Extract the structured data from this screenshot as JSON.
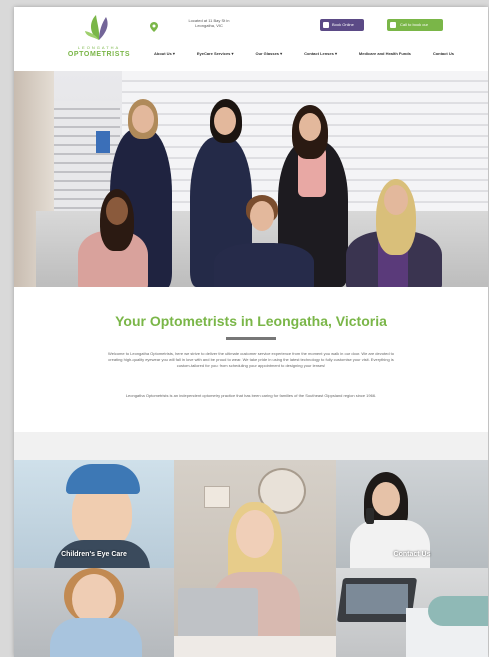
{
  "header": {
    "logo_top": "LEONGATHA",
    "logo_name": "OPTOMETRISTS",
    "location_line1": "Located at 11 Bay St in",
    "location_line2": "Leongatha, VIC",
    "book_label": "Book Online",
    "call_label": "Call to book our"
  },
  "nav": [
    {
      "label": "About Us ▾"
    },
    {
      "label": "EyeCare Services ▾"
    },
    {
      "label": "Our Glasses ▾"
    },
    {
      "label": "Contact Lenses ▾"
    },
    {
      "label": "Medicare and Health Funds"
    },
    {
      "label": "Contact Us"
    }
  ],
  "intro": {
    "title": "Your Optometrists in Leongatha, Victoria",
    "p1": "Welcome to Leongatha Optometrists, here we strive to deliver the ultimate customer service experience from the moment you walk in our door. We are devoted to creating high-quality eyewear you will fall in love with and be proud to wear. We take pride in using the latest technology to fully customise your visit. Everything is custom-tailored for you: from scheduling your appointment to designing your lenses!",
    "p2": "Leongatha Optometrists is an independent optometry practice that has been caring for families of the Southeast Gippsland region since 1966."
  },
  "tiles": {
    "childrens": "Children's Eye Care",
    "contact": "Contact Us"
  },
  "colors": {
    "brand_green": "#7ab648",
    "brand_purple": "#5b4a86"
  },
  "icons": {
    "location": "map-pin-icon",
    "book": "calendar-icon",
    "call": "phone-icon",
    "logo": "leaf-logo-icon"
  }
}
